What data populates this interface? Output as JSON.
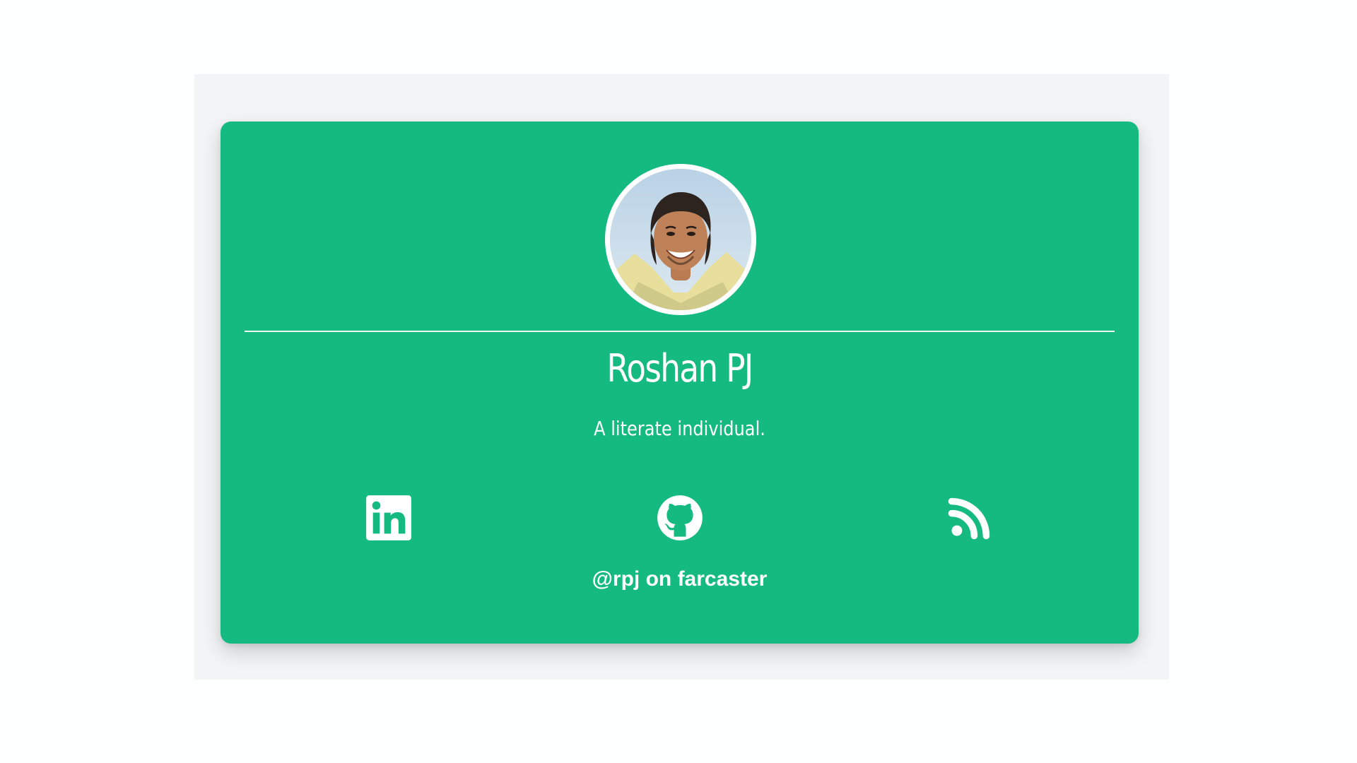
{
  "profile": {
    "name": "Roshan PJ",
    "tagline": "A literate individual.",
    "handle": "@rpj on farcaster"
  },
  "social_links": [
    {
      "icon": "linkedin-icon"
    },
    {
      "icon": "github-icon"
    },
    {
      "icon": "rss-icon"
    }
  ],
  "colors": {
    "card_background": "#14ba80",
    "page_background": "#f3f4f6",
    "text": "#ffffff"
  }
}
